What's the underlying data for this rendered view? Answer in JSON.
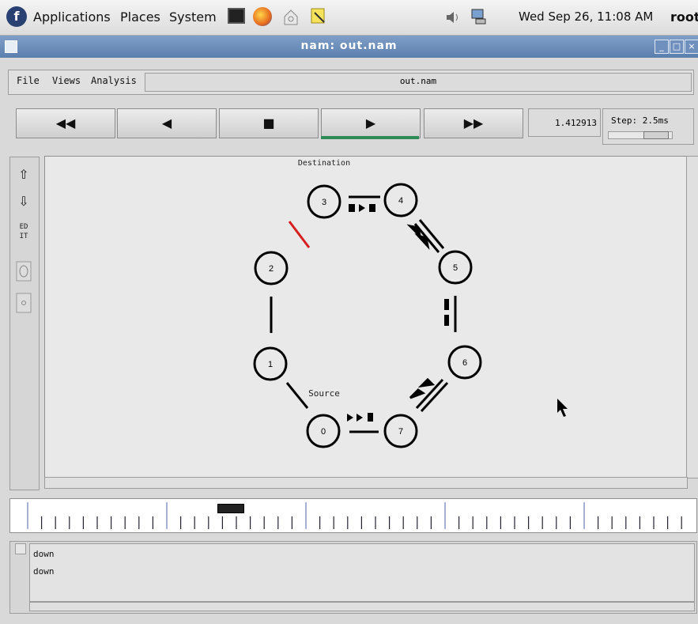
{
  "top_panel": {
    "menus": [
      "Applications",
      "Places",
      "System"
    ],
    "clock": "Wed Sep 26, 11:08 AM",
    "user": "root",
    "launcher_icons": [
      "terminal-icon",
      "firefox-icon",
      "network-icon",
      "notes-icon"
    ],
    "tray_icons": [
      "volume-icon",
      "network-monitor-icon"
    ]
  },
  "window": {
    "title": "nam: out.nam"
  },
  "menubar": {
    "items": [
      "File",
      "Views",
      "Analysis"
    ],
    "file_name": "out.nam"
  },
  "controls": {
    "rewind": "◀◀",
    "back": "◀",
    "stop": "■",
    "play": "▶",
    "fast_forward": "▶▶",
    "time": "1.412913",
    "step_label": "Step: 2.5ms"
  },
  "tools": [
    "zoom-in-icon",
    "zoom-out-icon",
    "edit-icon",
    "circle-tool-icon",
    "small-circle-icon"
  ],
  "tool_labels": {
    "edit": "ED\nIT"
  },
  "network": {
    "nodes": [
      "0",
      "1",
      "2",
      "3",
      "4",
      "5",
      "6",
      "7"
    ],
    "label_destination": "Destination",
    "label_source": "Source",
    "highlight_color": "#d62020"
  },
  "log": {
    "lines": [
      "down",
      "down"
    ]
  }
}
